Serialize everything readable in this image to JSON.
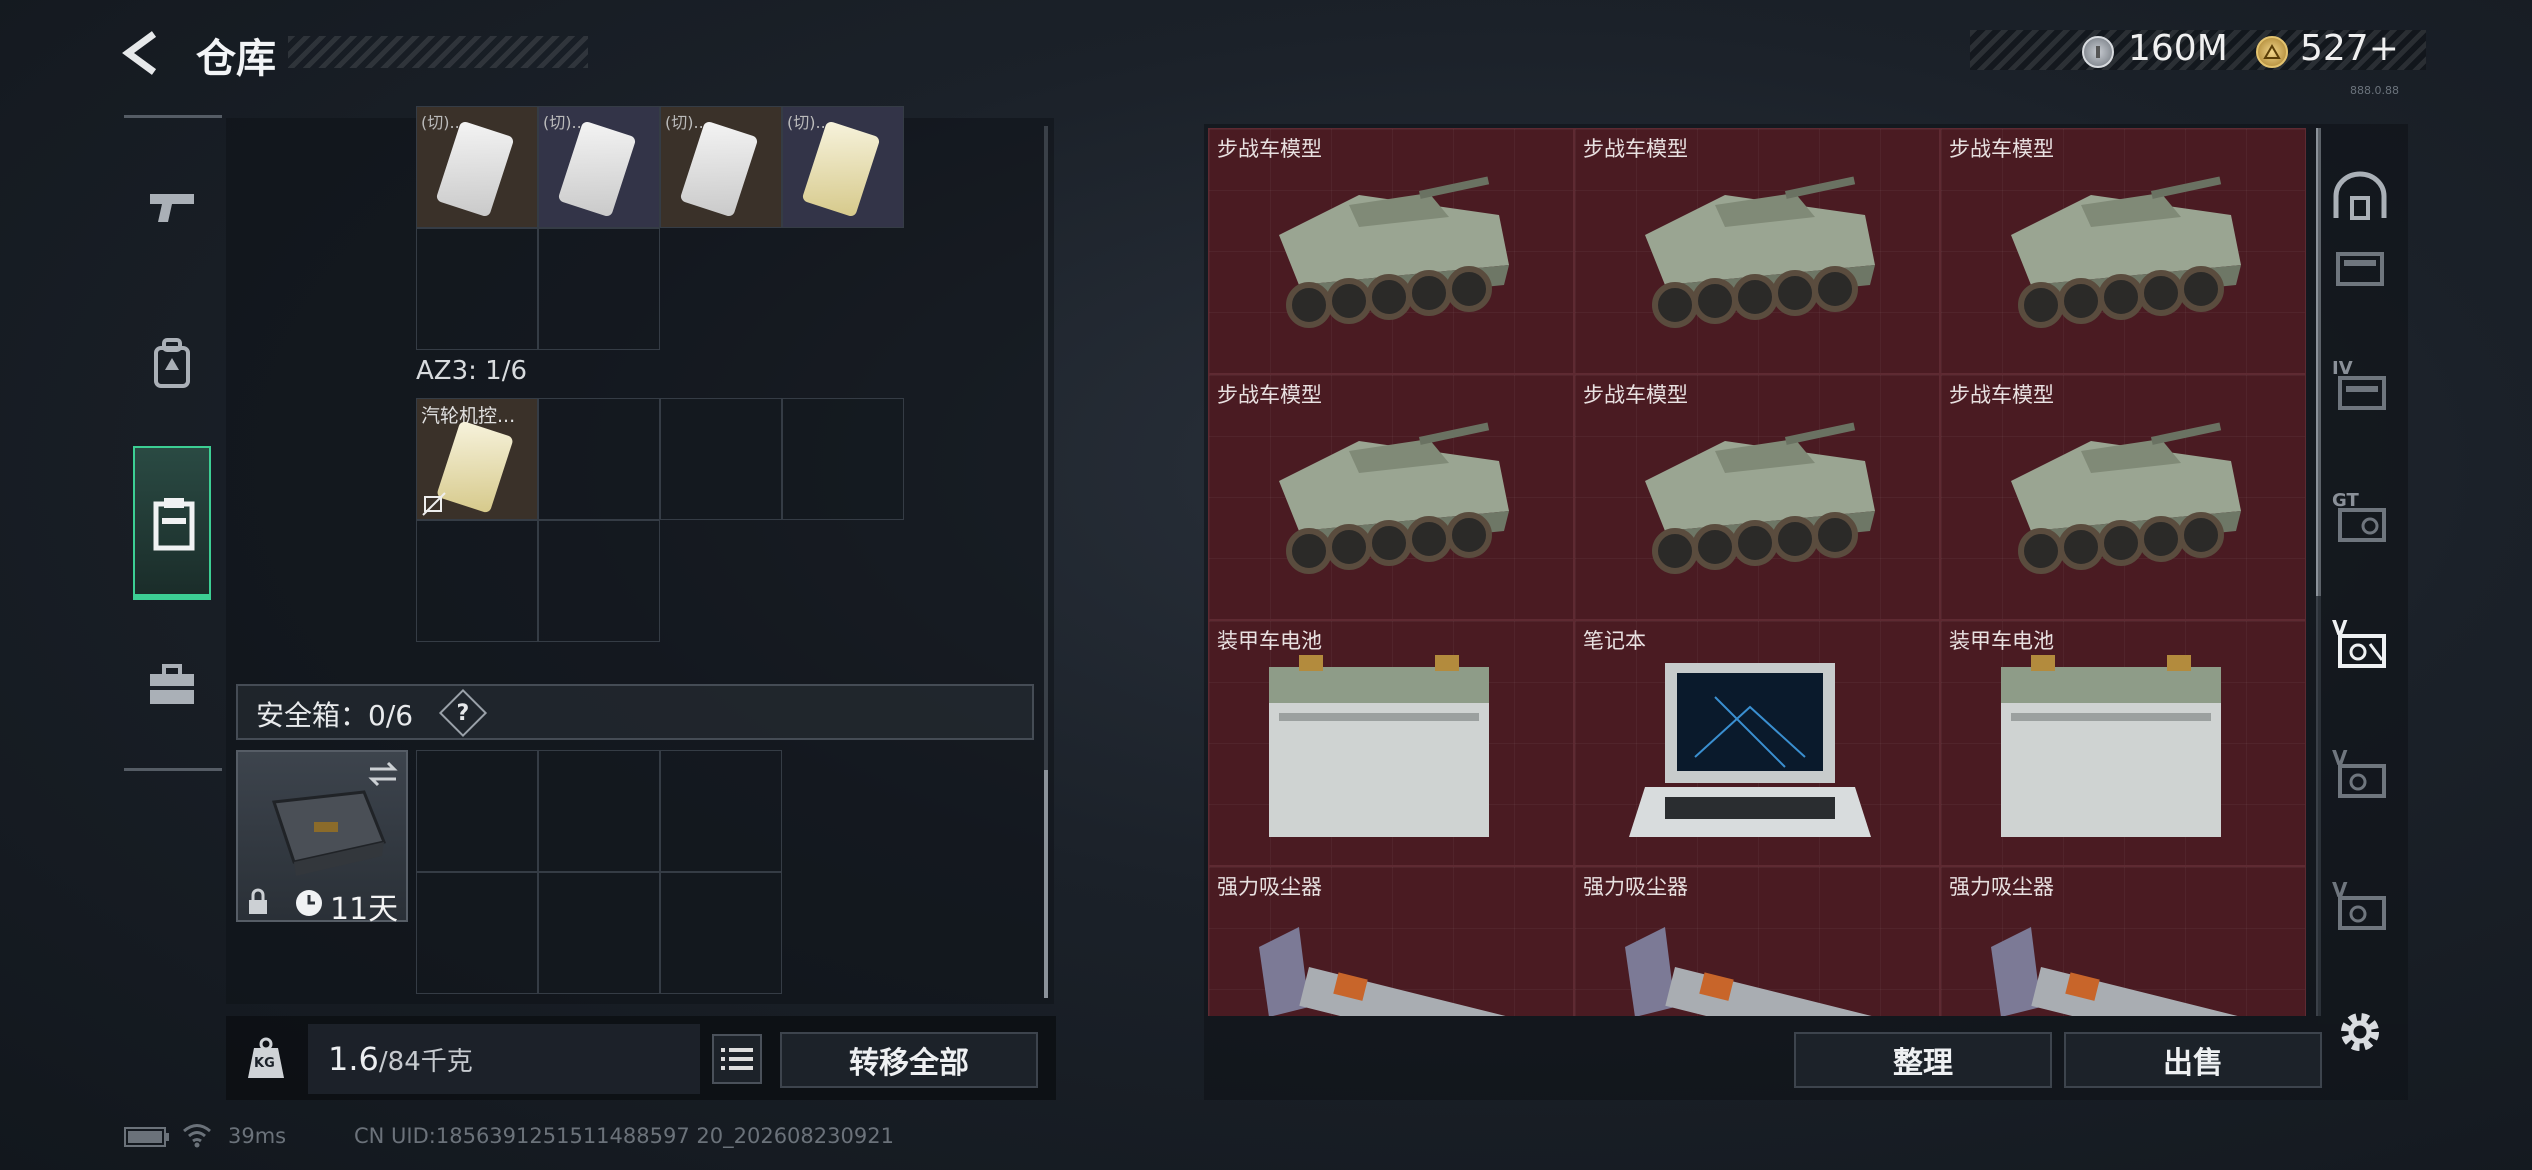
{
  "header": {
    "title": "仓库",
    "currency1": "160M",
    "currency2": "527+",
    "version_tag": "888.0.88"
  },
  "left_nav": [
    {
      "icon": "pistol-icon"
    },
    {
      "icon": "backpack-icon"
    },
    {
      "icon": "rig-icon"
    },
    {
      "icon": "toolbox-icon"
    }
  ],
  "container": {
    "top_items": [
      "(切)...",
      "(切)...",
      "(切)...",
      "(切)..."
    ],
    "az3_label": "AZ3: 1/6",
    "az3_item": "汽轮机控...",
    "safebox_label": "安全箱：0/6",
    "safebox_help": "?",
    "safebox_timer": "11天"
  },
  "footer": {
    "weight_value": "1.6",
    "weight_max": "/84千克",
    "kg": "KG",
    "transfer_all": "转移全部"
  },
  "status": {
    "ping": "39ms",
    "uid": "CN UID:1856391251511488597 20_202608230921"
  },
  "storage": {
    "items": [
      {
        "label": "步战车模型",
        "type": "ifv"
      },
      {
        "label": "步战车模型",
        "type": "ifv"
      },
      {
        "label": "步战车模型",
        "type": "ifv"
      },
      {
        "label": "步战车模型",
        "type": "ifv"
      },
      {
        "label": "步战车模型",
        "type": "ifv"
      },
      {
        "label": "步战车模型",
        "type": "ifv"
      },
      {
        "label": "装甲车电池",
        "type": "battery"
      },
      {
        "label": "笔记本",
        "type": "laptop"
      },
      {
        "label": "装甲车电池",
        "type": "battery"
      },
      {
        "label": "强力吸尘器",
        "type": "vacuum"
      },
      {
        "label": "强力吸尘器",
        "type": "vacuum"
      },
      {
        "label": "强力吸尘器",
        "type": "vacuum"
      }
    ],
    "sort_button": "整理",
    "sell_button": "出售"
  },
  "right_nav": [
    {
      "icon": "arch-icon",
      "tag": ""
    },
    {
      "icon": "box-icon",
      "tag": ""
    },
    {
      "icon": "box-icon",
      "tag": "IV"
    },
    {
      "icon": "box-icon",
      "tag": "GT"
    },
    {
      "icon": "box-icon",
      "tag": "V"
    },
    {
      "icon": "box-icon",
      "tag": "V"
    },
    {
      "icon": "box-icon",
      "tag": "V"
    }
  ],
  "colors": {
    "accent_green": "#3ccf94",
    "item_red": "#4a1b22"
  }
}
